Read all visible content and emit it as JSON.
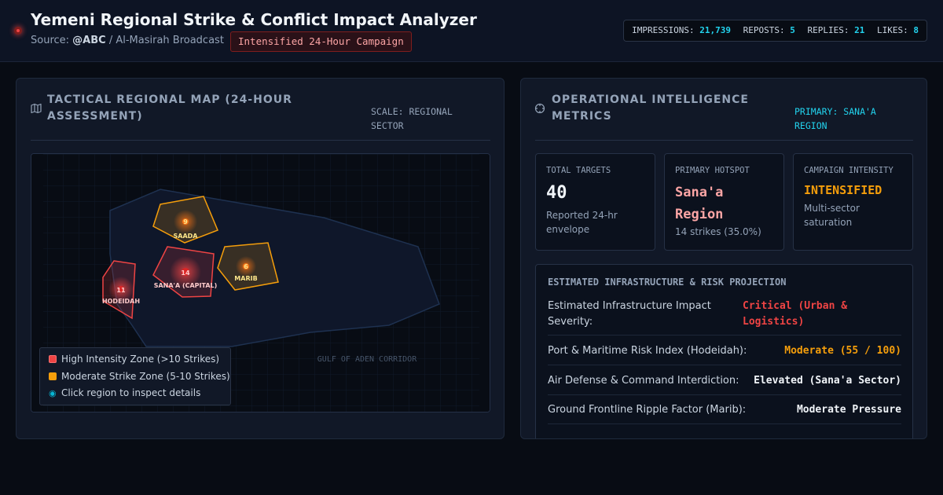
{
  "header": {
    "title": "Yemeni Regional Strike & Conflict Impact Analyzer",
    "source_prefix": "Source:",
    "source_handle": "@ABC",
    "source_rest": " / Al-Masirah Broadcast",
    "badge": "Intensified 24-Hour Campaign",
    "stats": [
      {
        "label": "IMPRESSIONS:",
        "value": "21,739"
      },
      {
        "label": "REPOSTS:",
        "value": "5"
      },
      {
        "label": "REPLIES:",
        "value": "21"
      },
      {
        "label": "LIKES:",
        "value": "8"
      }
    ]
  },
  "map_panel": {
    "icon": "map-icon",
    "title_line1": "TACTICAL REGIONAL MAP (24-HOUR",
    "title_line2": "ASSESSMENT)",
    "scale_line1": "SCALE: REGIONAL",
    "scale_line2": "SECTOR",
    "water_label": "GULF OF ADEN CORRIDOR",
    "regions": [
      {
        "name": "SAADA",
        "strikes": "9",
        "level": "moderate"
      },
      {
        "name": "SANA'A (CAPITAL)",
        "strikes": "14",
        "level": "high"
      },
      {
        "name": "MARIB",
        "strikes": "6",
        "level": "moderate"
      },
      {
        "name": "HODEIDAH",
        "strikes": "11",
        "level": "high"
      }
    ],
    "legend": {
      "high": "High Intensity Zone (>10 Strikes)",
      "moderate": "Moderate Strike Zone (5-10 Strikes)",
      "inspect": "Click region to inspect details"
    },
    "colors": {
      "high": "#ef4444",
      "moderate": "#f59e0b"
    }
  },
  "metrics_panel": {
    "icon": "target-icon",
    "title_line1": "OPERATIONAL INTELLIGENCE",
    "title_line2": "METRICS",
    "primary_line1": "PRIMARY: SANA'A",
    "primary_line2": "REGION",
    "cards": [
      {
        "label": "TOTAL TARGETS",
        "value": "40",
        "note_line1": "Reported 24-hr",
        "note_line2": "envelope"
      },
      {
        "label": "PRIMARY HOTSPOT",
        "value_line1": "Sana'a",
        "value_line2": "Region",
        "note_line1": "14 strikes (35.0%)"
      },
      {
        "label": "CAMPAIGN INTENSITY",
        "value": "INTENSIFIED",
        "note_line1": "Multi-sector",
        "note_line2": "saturation"
      }
    ],
    "risk": {
      "title": "ESTIMATED INFRASTRUCTURE & RISK PROJECTION",
      "rows": [
        {
          "label_line1": "Estimated Infrastructure Impact",
          "label_line2": "Severity:",
          "value_line1": "Critical (Urban &",
          "value_line2": "Logistics)"
        },
        {
          "label_line1": "Port & Maritime Risk Index (Hodeidah):",
          "value_line1": "Moderate (55 / 100)"
        },
        {
          "label_line1": "Air Defense & Command Interdiction:",
          "value_line1": "Elevated (Sana'a Sector)"
        },
        {
          "label_line1": "Ground Frontline Ripple Factor (Marib):",
          "value_line1": "Moderate Pressure"
        }
      ],
      "colors": {
        "critical": "#ef4444",
        "moderate": "#f59e0b",
        "neutral": "#f1f5f9"
      }
    }
  }
}
